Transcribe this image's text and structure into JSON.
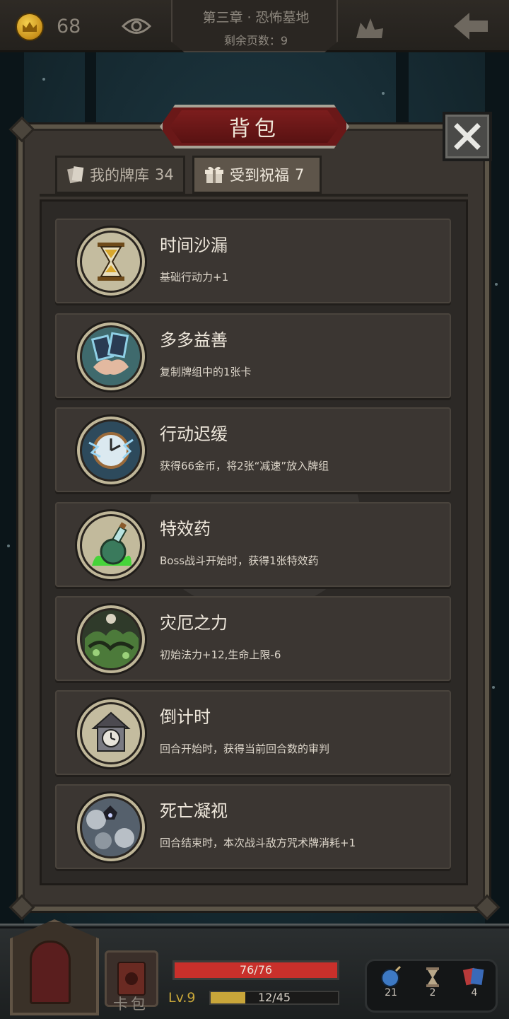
{
  "top_bar": {
    "gold": "68",
    "chapter_title": "第三章 · 恐怖墓地",
    "remaining_pages": "剩余页数：9"
  },
  "panel": {
    "title": "背包",
    "tabs": [
      {
        "label": "我的牌库",
        "count": "34",
        "active": false
      },
      {
        "label": "受到祝福",
        "count": "7",
        "active": true
      }
    ]
  },
  "blessings": [
    {
      "name": "时间沙漏",
      "description": "基础行动力+1",
      "icon": "hourglass-icon"
    },
    {
      "name": "多多益善",
      "description": "复制牌组中的1张卡",
      "icon": "duplicate-cards-icon"
    },
    {
      "name": "行动迟缓",
      "description": "获得66金币，将2张“减速”放入牌组",
      "icon": "frozen-clock-icon"
    },
    {
      "name": "特效药",
      "description": "Boss战斗开始时，获得1张特效药",
      "icon": "potion-icon"
    },
    {
      "name": "灾厄之力",
      "description": "初始法力+12,生命上限-6",
      "icon": "calamity-icon"
    },
    {
      "name": "倒计时",
      "description": "回合开始时，获得当前回合数的审判",
      "icon": "cuckoo-clock-icon"
    },
    {
      "name": "死亡凝视",
      "description": "回合结束时，本次战斗敌方咒术牌消耗+1",
      "icon": "death-gaze-icon"
    }
  ],
  "hud": {
    "card_bag_label": "卡包",
    "hp": "76/76",
    "hp_ratio": 1.0,
    "level": "Lv.9",
    "xp": "12/45",
    "xp_ratio": 0.27,
    "resources": [
      {
        "icon": "bomb-icon",
        "count": "21"
      },
      {
        "icon": "hourglass-small-icon",
        "count": "2"
      },
      {
        "icon": "cards-icon",
        "count": "4"
      }
    ]
  },
  "colors": {
    "banner_red": "#6a1818",
    "hp_red": "#c9302b",
    "xp_gold": "#c9a63a",
    "item_bg": "#3b3632"
  }
}
